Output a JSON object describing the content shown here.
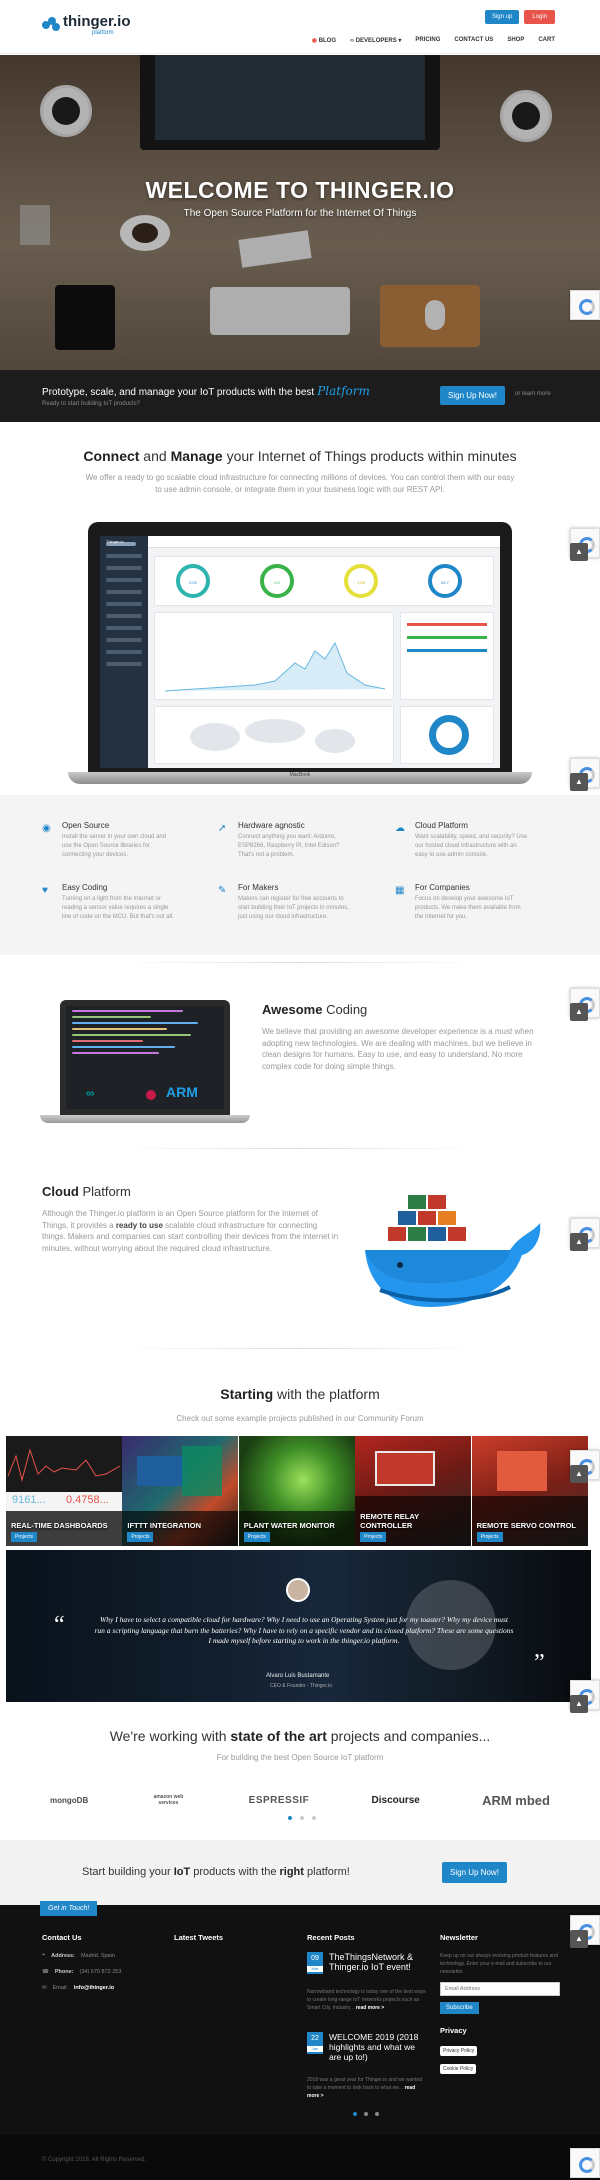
{
  "header": {
    "brand": "thinger.io",
    "brand_sub": "platform",
    "signup": "Sign up",
    "login": "Login",
    "nav": [
      "BLOG",
      "DEVELOPERS",
      "PRICING",
      "CONTACT US",
      "SHOP",
      "CART"
    ]
  },
  "hero": {
    "title": "WELCOME TO THINGER.IO",
    "subtitle": "The Open Source Platform for the Internet Of Things"
  },
  "promo": {
    "title": "Prototype, scale, and manage your IoT products with the best",
    "title_script": "Platform",
    "subtitle": "Ready to start building IoT products?",
    "cta": "Sign Up Now!",
    "learn": "or learn more"
  },
  "connect": {
    "title_a": "Connect",
    "title_b": " and ",
    "title_c": "Manage",
    "title_d": " your Internet of Things products within minutes",
    "text": "We offer a ready to go scalable cloud infrastructure for connecting millions of devices. You can control them with our easy to use admin console, or integrate them in your business logic with our REST API.",
    "laptop_brand": "MacBook",
    "dash_brand": "Thinger.io",
    "dash_gauges": [
      "0.00",
      "0.0",
      "1.00",
      "54.7"
    ]
  },
  "features": [
    {
      "icon": "github-icon",
      "glyph": "◉",
      "title": "Open Source",
      "text": "Install the server in your own cloud and use the Open Source libraries for connecting your devices."
    },
    {
      "icon": "rocket-icon",
      "glyph": "➚",
      "title": "Hardware agnostic",
      "text": "Connect anything you want: Arduino, ESP8266, Raspberry Pi, Intel Edison? That's not a problem."
    },
    {
      "icon": "cloud-icon",
      "glyph": "☁",
      "title": "Cloud Platform",
      "text": "Want scalability, speed, and security? Use our hosted cloud infrastructure with an easy to use admin console."
    },
    {
      "icon": "heart-icon",
      "glyph": "♥",
      "title": "Easy Coding",
      "text": "Turning on a light from the Internet or reading a sensor value requires a single line of code on the MCU. But that's not all."
    },
    {
      "icon": "wrench-icon",
      "glyph": "✎",
      "title": "For Makers",
      "text": "Makers can register for free accounts to start building their IoT projects in minutes, just using our cloud infrastructure."
    },
    {
      "icon": "building-icon",
      "glyph": "▦",
      "title": "For Companies",
      "text": "Focus on develop your awesome IoT products. We make them available from the Internet for you."
    }
  ],
  "coding": {
    "title_a": "Awesome",
    "title_b": " Coding",
    "text": "We believe that providing an awesome developer experience is a must when adopting new technologies. We are dealing with machines, but we believe in clean designs for humans. Easy to use, and easy to understand. No more complex code for doing simple things.",
    "logo_arm": "ARM"
  },
  "cloud": {
    "title_a": "Cloud",
    "title_b": " Platform",
    "text_a": "Although the Thinger.io platform is an Open Source platform for the Internet of Things, it provides a ",
    "text_b": "ready to use",
    "text_c": " scalable cloud infrastructure for connecting things. Makers and companies can start controlling their devices from the internet in minutes, without worrying about the required cloud infrastructure."
  },
  "starting": {
    "title_a": "Starting",
    "title_b": " with the platform",
    "text": "Check out some example projects published in our Community Forum",
    "projects": [
      {
        "title": "REAL-TIME DASHBOARDS",
        "tag": "Projects",
        "num1": "9161...",
        "num2": "0.4758..."
      },
      {
        "title": "IFTTT INTEGRATION",
        "tag": "Projects"
      },
      {
        "title": "PLANT WATER MONITOR",
        "tag": "Projects"
      },
      {
        "title": "REMOTE RELAY CONTROLLER",
        "tag": "Projects"
      },
      {
        "title": "REMOTE SERVO CONTROL",
        "tag": "Projects"
      }
    ]
  },
  "quote": {
    "text": "Why I have to select a compatible cloud for hardware? Why I need to use an Operating System just for my toaster? Why my device must run a scripting language that burn the batteries? Why I have to rely on a specific vendor and its closed platform? These are some questions I made myself before starting to work in the thinger.io platform.",
    "author": "Alvaro Luis Bustamante",
    "role": "CEO & Founder - Thinger.io"
  },
  "partners_sec": {
    "title_a": "We're working with ",
    "title_b": "state of the art",
    "title_c": " projects and companies...",
    "text": "For building the best Open Source IoT platform",
    "logos": [
      "mongoDB",
      "amazon web services",
      "ESPRESSIF",
      "Discourse",
      "ARM mbed"
    ]
  },
  "cta": {
    "text_a": "Start building your ",
    "text_b": "IoT",
    "text_c": " products with the ",
    "text_d": "right",
    "text_e": " platform!",
    "btn": "Sign Up Now!"
  },
  "footer": {
    "get_in_touch": "Get in Touch!",
    "contact_title": "Contact Us",
    "address_label": "Address:",
    "address": "Madrid, Spain",
    "phone_label": "Phone:",
    "phone": "(34) 670 872 253",
    "email_label": "Email:",
    "email": "info@thinger.io",
    "tweets_title": "Latest Tweets",
    "posts_title": "Recent Posts",
    "posts": [
      {
        "day": "09",
        "month": "Mar",
        "title": "TheThingsNetwork & Thinger.io IoT event!",
        "text": "Narrowband technology is today one of the best ways to create long-range IoT networks projects such as Smart City, Industry...",
        "more": "read more >"
      },
      {
        "day": "22",
        "month": "Jan",
        "title": "WELCOME 2019 (2018 highlights and what we are up to!)",
        "text": "2018 was a great year for Thinger.io and we wanted to take a moment to look back to what we...",
        "more": "read more >"
      }
    ],
    "newsletter_title": "Newsletter",
    "newsletter_text": "Keep up on our always evolving product features and technology. Enter your e-mail and subscribe to our newsletter.",
    "email_placeholder": "Email Address",
    "subscribe": "Subscribe",
    "privacy_title": "Privacy",
    "privacy_policy": "Privacy Policy",
    "cookie_policy": "Cookie Policy",
    "copyright": "© Copyright 2018. All Rights Reserved."
  }
}
